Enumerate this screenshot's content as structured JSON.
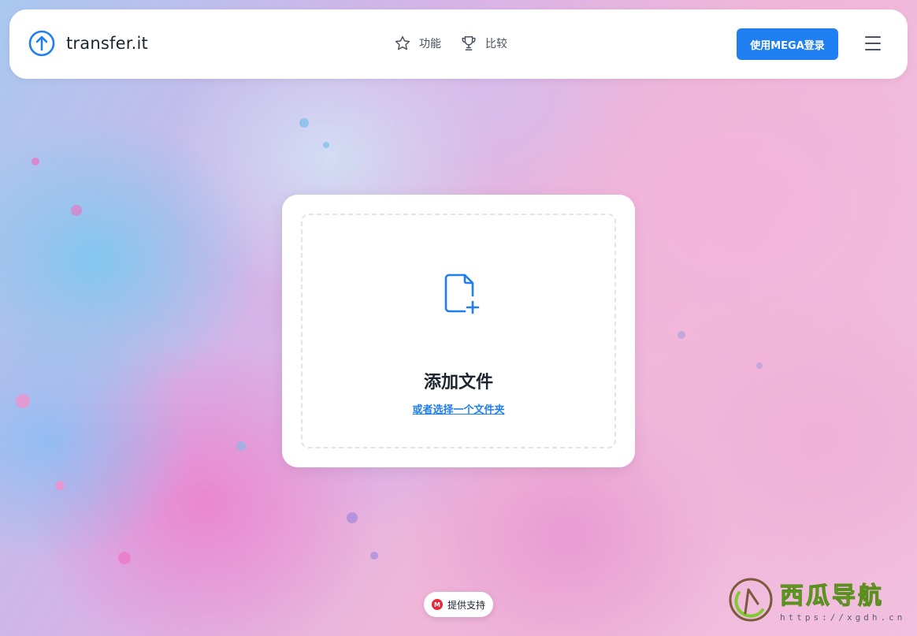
{
  "header": {
    "brand": "transfer.it",
    "nav": [
      {
        "label": "功能",
        "icon": "star-icon"
      },
      {
        "label": "比较",
        "icon": "trophy-icon"
      }
    ],
    "login_label": "使用MEGA登录",
    "menu_icon": "hamburger-menu-icon"
  },
  "upload": {
    "icon": "file-add-icon",
    "title": "添加文件",
    "folder_link": "或者选择一个文件夹"
  },
  "support": {
    "badge": "M",
    "label": "提供支持"
  },
  "watermark": {
    "title": "西瓜导航",
    "url": "https://xgdh.cn"
  },
  "colors": {
    "accent": "#1f7ef1",
    "mega_red": "#e6283a",
    "text_dark": "#1c2430"
  }
}
